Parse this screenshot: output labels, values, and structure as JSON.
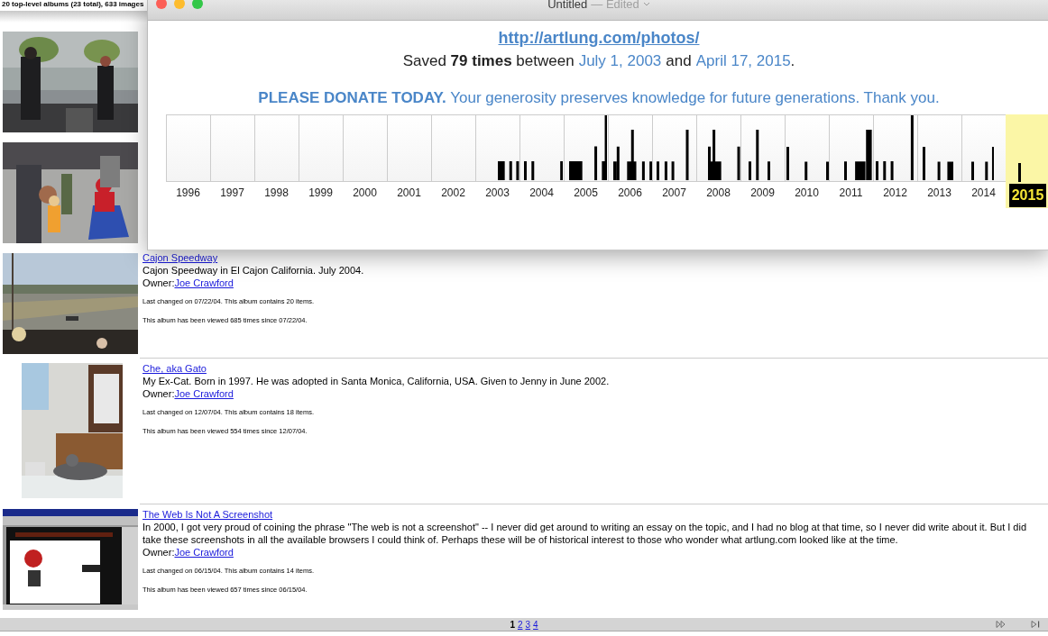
{
  "header": "20 top-level albums (23 total), 633 images",
  "albums": [
    {
      "title": "Cajon Speedway",
      "description": "Cajon Speedway in El Cajon California. July 2004.",
      "owner_label": "Owner:",
      "owner": "Joe Crawford",
      "changed": "Last changed on 07/22/04. This album contains 20 items.",
      "viewed": "This album has been viewed 685 times since 07/22/04."
    },
    {
      "title": "Che, aka Gato",
      "description": "My Ex-Cat. Born in 1997. He was adopted in Santa Monica, California, USA. Given to Jenny in June 2002.",
      "owner_label": "Owner:",
      "owner": "Joe Crawford",
      "changed": "Last changed on 12/07/04. This album contains 18 items.",
      "viewed": "This album has been viewed 554 times since 12/07/04."
    },
    {
      "title": "The Web Is Not A Screenshot",
      "description": "In 2000, I got very proud of coining the phrase \"The web is not a screenshot\" -- I never did get around to writing an essay on the topic, and I had no blog at that time, so I never did write about it. But I did take these screenshots in all the available browsers I could think of. Perhaps these will be of historical interest to those who wonder what artlung.com looked like at the time.",
      "owner_label": "Owner:",
      "owner": "Joe Crawford",
      "changed": "Last changed on 06/15/04. This album contains 14 items.",
      "viewed": "This album has been viewed 657 times since 06/15/04."
    }
  ],
  "pages": [
    {
      "label": "1",
      "selected": true
    },
    {
      "label": "2",
      "selected": false
    },
    {
      "label": "3",
      "selected": false
    },
    {
      "label": "4",
      "selected": false
    }
  ],
  "window": {
    "title": "Untitled",
    "status": "— Edited",
    "url": "http://artlung.com/photos/",
    "saved": "Saved **79 times** between",
    "first_date": "July 1, 2003",
    "and": "and",
    "last_date": "April 17, 2015",
    "period": ".",
    "donate_bold": "PLEASE DONATE TODAY.",
    "donate_text": "Your generosity preserves knowledge for future generations. Thank you.",
    "years": [
      {
        "label": "1996",
        "selected": false
      },
      {
        "label": "1997",
        "selected": false
      },
      {
        "label": "1998",
        "selected": false
      },
      {
        "label": "1999",
        "selected": false
      },
      {
        "label": "2000",
        "selected": false
      },
      {
        "label": "2001",
        "selected": false
      },
      {
        "label": "2002",
        "selected": false
      },
      {
        "label": "2003",
        "selected": false
      },
      {
        "label": "2004",
        "selected": false
      },
      {
        "label": "2005",
        "selected": false
      },
      {
        "label": "2006",
        "selected": false
      },
      {
        "label": "2007",
        "selected": false
      },
      {
        "label": "2008",
        "selected": false
      },
      {
        "label": "2009",
        "selected": false
      },
      {
        "label": "2010",
        "selected": false
      },
      {
        "label": "2011",
        "selected": false
      },
      {
        "label": "2012",
        "selected": false
      },
      {
        "label": "2013",
        "selected": false
      },
      {
        "label": "2014",
        "selected": false
      },
      {
        "label": "2015",
        "selected": true
      }
    ]
  }
}
